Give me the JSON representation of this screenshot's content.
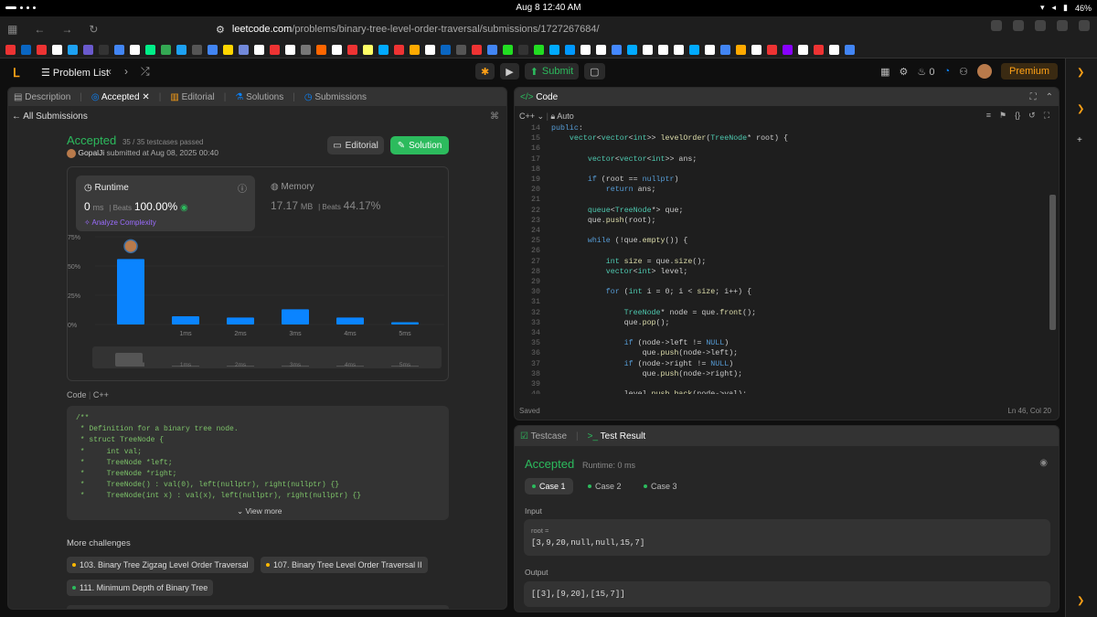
{
  "os": {
    "clock": "Aug 8  12:40 AM",
    "battery": "46%"
  },
  "browser": {
    "url_host": "leetcode.com",
    "url_path": "/problems/binary-tree-level-order-traversal/submissions/1727267684/",
    "bookmark_colors": [
      "#e33",
      "#0a66c2",
      "#e33",
      "#fff",
      "#1da1f2",
      "#6a5acd",
      "#333",
      "#4285f4",
      "#fff",
      "#0e8",
      "#34a853",
      "#1da1f2",
      "#555",
      "#4285f4",
      "#ffd600",
      "#7289da",
      "#fff",
      "#e33",
      "#fff",
      "#777",
      "#f60",
      "#fff",
      "#e33",
      "#ff6",
      "#0af",
      "#e33",
      "#fa0",
      "#fff",
      "#0a66c2",
      "#555",
      "#e33",
      "#4285f4",
      "#2d2",
      "#333",
      "#2d2",
      "#0af",
      "#09f",
      "#fff",
      "#fff",
      "#48f",
      "#0af",
      "#fff",
      "#fff",
      "#fff",
      "#0af",
      "#fff",
      "#4285f4",
      "#fa0",
      "#fff",
      "#e33",
      "#80f",
      "#fff",
      "#e33",
      "#fff",
      "#4285f4"
    ]
  },
  "lc": {
    "problem_list": "Problem List",
    "submit": "Submit",
    "streak": "0",
    "premium": "Premium"
  },
  "left_tabs": {
    "description": "Description",
    "accepted": "Accepted",
    "editorial": "Editorial",
    "solutions": "Solutions",
    "submissions": "Submissions"
  },
  "back_label": "All Submissions",
  "result": {
    "status": "Accepted",
    "testcases": "35 / 35 testcases passed",
    "user": "GopalJi",
    "submitted": "submitted at Aug 08, 2025 00:40",
    "editorial_btn": "Editorial",
    "solution_btn": "Solution"
  },
  "runtime": {
    "label": "Runtime",
    "value": "0",
    "unit": "ms",
    "beats_label": "Beats",
    "beats": "100.00%",
    "analyze": "Analyze Complexity"
  },
  "memory": {
    "label": "Memory",
    "value": "17.17",
    "unit": "MB",
    "beats_label": "Beats",
    "beats": "44.17%"
  },
  "chart_data": {
    "type": "bar",
    "ylabel_ticks": [
      "75%",
      "50%",
      "25%",
      "0%"
    ],
    "yticks": [
      75,
      50,
      25,
      0
    ],
    "ylim": [
      0,
      75
    ],
    "categories": [
      "0ms",
      "1ms",
      "2ms",
      "3ms",
      "4ms",
      "5ms"
    ],
    "x_tick_labels": [
      "",
      "1ms",
      "2ms",
      "3ms",
      "4ms",
      "5ms"
    ],
    "values": [
      56,
      7,
      6,
      13,
      6,
      2
    ],
    "highlight_index": 0,
    "color": "#0a84ff"
  },
  "code_section": {
    "label": "Code",
    "lang": "C++",
    "lines": [
      "/**",
      " * Definition for a binary tree node.",
      " * struct TreeNode {",
      " *     int val;",
      " *     TreeNode *left;",
      " *     TreeNode *right;",
      " *     TreeNode() : val(0), left(nullptr), right(nullptr) {}",
      " *     TreeNode(int x) : val(x), left(nullptr), right(nullptr) {}"
    ],
    "view_more": "View more"
  },
  "more": {
    "title": "More challenges",
    "items": [
      {
        "label": "103. Binary Tree Zigzag Level Order Traversal",
        "color": "#ffb800"
      },
      {
        "label": "107. Binary Tree Level Order Traversal II",
        "color": "#ffb800"
      },
      {
        "label": "111. Minimum Depth of Binary Tree",
        "color": "#2cbb5d"
      }
    ]
  },
  "editor": {
    "title": "Code",
    "lang": "C++",
    "auto": "Auto",
    "saved": "Saved",
    "cursor": "Ln 46, Col 20",
    "lines": [
      {
        "n": "14",
        "t": "public:"
      },
      {
        "n": "15",
        "t": "    vector<vector<int>> levelOrder(TreeNode* root) {"
      },
      {
        "n": "16",
        "t": ""
      },
      {
        "n": "17",
        "t": "        vector<vector<int>> ans;"
      },
      {
        "n": "18",
        "t": ""
      },
      {
        "n": "19",
        "t": "        if (root == nullptr)"
      },
      {
        "n": "20",
        "t": "            return ans;"
      },
      {
        "n": "21",
        "t": ""
      },
      {
        "n": "22",
        "t": "        queue<TreeNode*> que;"
      },
      {
        "n": "23",
        "t": "        que.push(root);"
      },
      {
        "n": "24",
        "t": ""
      },
      {
        "n": "25",
        "t": "        while (!que.empty()) {"
      },
      {
        "n": "26",
        "t": ""
      },
      {
        "n": "27",
        "t": "            int size = que.size();"
      },
      {
        "n": "28",
        "t": "            vector<int> level;"
      },
      {
        "n": "29",
        "t": ""
      },
      {
        "n": "30",
        "t": "            for (int i = 0; i < size; i++) {"
      },
      {
        "n": "31",
        "t": ""
      },
      {
        "n": "32",
        "t": "                TreeNode* node = que.front();"
      },
      {
        "n": "33",
        "t": "                que.pop();"
      },
      {
        "n": "34",
        "t": ""
      },
      {
        "n": "35",
        "t": "                if (node->left != NULL)"
      },
      {
        "n": "36",
        "t": "                    que.push(node->left);"
      },
      {
        "n": "37",
        "t": "                if (node->right != NULL)"
      },
      {
        "n": "38",
        "t": "                    que.push(node->right);"
      },
      {
        "n": "39",
        "t": ""
      },
      {
        "n": "40",
        "t": "                level.push_back(node->val);"
      }
    ]
  },
  "test": {
    "tab_testcase": "Testcase",
    "tab_result": "Test Result",
    "status": "Accepted",
    "runtime": "Runtime: 0 ms",
    "cases": [
      "Case 1",
      "Case 2",
      "Case 3"
    ],
    "input_label": "Input",
    "input_var": "root =",
    "input_value": "[3,9,20,null,null,15,7]",
    "output_label": "Output",
    "output_value": "[[3],[9,20],[15,7]]"
  }
}
